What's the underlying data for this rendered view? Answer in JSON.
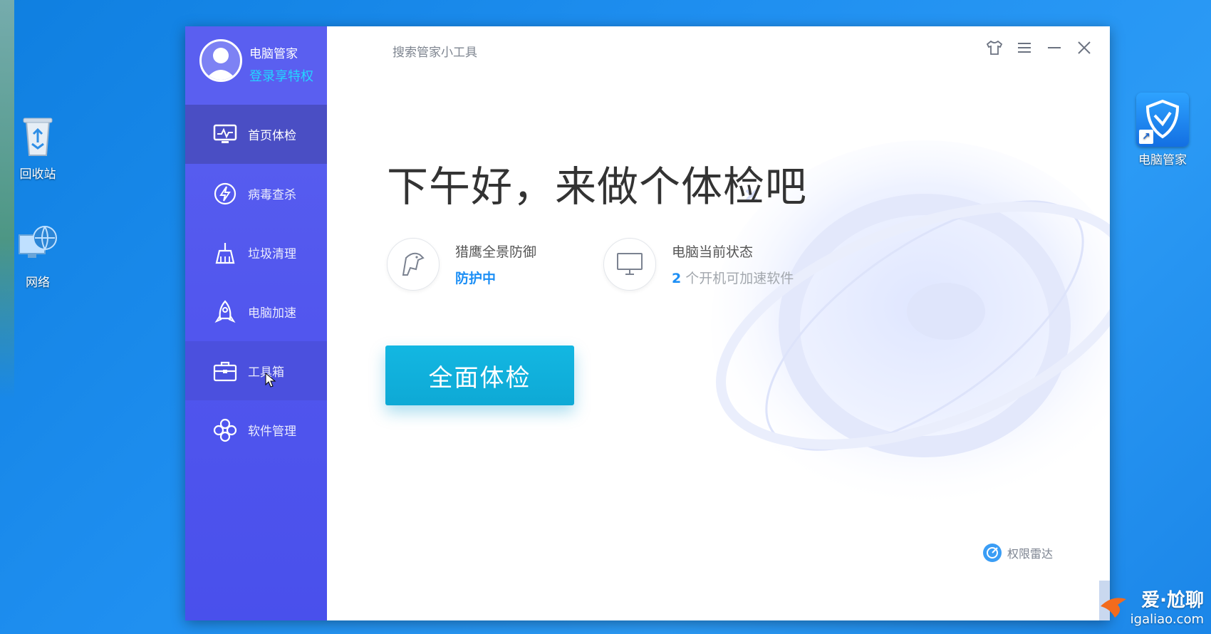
{
  "desktop": {
    "icons": [
      {
        "label": "回收站"
      },
      {
        "label": "网络"
      }
    ],
    "shortcut": {
      "label": "电脑管家"
    }
  },
  "app": {
    "name": "电脑管家",
    "login_link": "登录享特权",
    "search_tools": "搜索管家小工具",
    "nav": [
      {
        "label": "首页体检",
        "icon": "monitor-pulse-icon"
      },
      {
        "label": "病毒查杀",
        "icon": "lightning-icon"
      },
      {
        "label": "垃圾清理",
        "icon": "broom-icon"
      },
      {
        "label": "电脑加速",
        "icon": "rocket-icon"
      },
      {
        "label": "工具箱",
        "icon": "toolbox-icon"
      },
      {
        "label": "软件管理",
        "icon": "apps-icon"
      }
    ],
    "greeting": "下午好，来做个体检吧",
    "status": [
      {
        "title": "猎鹰全景防御",
        "sub": "防护中"
      },
      {
        "title": "电脑当前状态",
        "count": "2",
        "sub": "个开机可加速软件"
      }
    ],
    "scan_button": "全面体检",
    "radar": "权限雷达"
  },
  "watermark": {
    "main": "爱·尬聊",
    "url": "igaliao.com"
  },
  "colors": {
    "sidebar": "#5257ee",
    "active_nav": "#4a4ec4",
    "accent_blue": "#1d8ff5",
    "scan_button": "#13b7e2",
    "login_link": "#23d6ff"
  }
}
